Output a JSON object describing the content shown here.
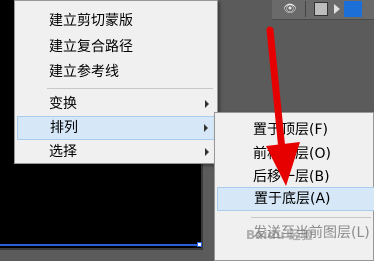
{
  "menu": {
    "items": [
      {
        "label": "建立剪切蒙版"
      },
      {
        "label": "建立复合路径"
      },
      {
        "label": "建立参考线"
      },
      {
        "label": "变换"
      },
      {
        "label": "排列"
      },
      {
        "label": "选择"
      }
    ]
  },
  "submenu": {
    "items": [
      {
        "label": "置于顶层(F)"
      },
      {
        "label": "前移一层(O)"
      },
      {
        "label": "后移一层(B)"
      },
      {
        "label": "置于底层(A)"
      },
      {
        "label": "发送至当前图层(L)"
      }
    ]
  },
  "colors": {
    "highlight": "#d6e8f7",
    "annotation_arrow": "#e60000",
    "layer_color": "#1b6fd6"
  },
  "icons": {
    "eye": "eye-icon",
    "submenu_arrow": "chevron-right-icon"
  },
  "watermark": {
    "text": "Baidu 经验"
  }
}
